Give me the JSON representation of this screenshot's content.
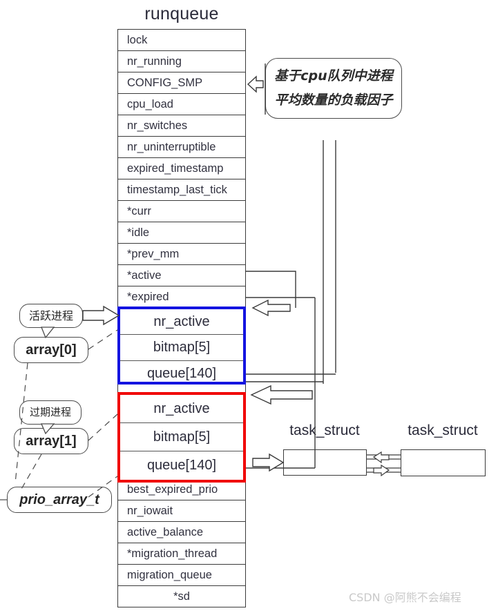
{
  "diagram": {
    "title": "runqueue",
    "runqueue_fields": [
      {
        "label": "lock",
        "align": "left"
      },
      {
        "label": "nr_running",
        "align": "left"
      },
      {
        "label": "CONFIG_SMP",
        "align": "left"
      },
      {
        "label": "cpu_load",
        "align": "left"
      },
      {
        "label": "nr_switches",
        "align": "left"
      },
      {
        "label": "nr_uninterruptible",
        "align": "left"
      },
      {
        "label": "expired_timestamp",
        "align": "left"
      },
      {
        "label": "timestamp_last_tick",
        "align": "left"
      },
      {
        "label": "*curr",
        "align": "left"
      },
      {
        "label": "*idle",
        "align": "left"
      },
      {
        "label": "*prev_mm",
        "align": "left"
      },
      {
        "label": "*active",
        "align": "left"
      },
      {
        "label": "*expired",
        "align": "left"
      },
      {
        "label": "",
        "align": "left"
      },
      {
        "label": "",
        "align": "left"
      },
      {
        "label": "",
        "align": "left"
      },
      {
        "label": "",
        "align": "left"
      },
      {
        "label": "",
        "align": "left"
      },
      {
        "label": "",
        "align": "left"
      },
      {
        "label": "",
        "align": "left"
      },
      {
        "label": "",
        "align": "left"
      },
      {
        "label": "best_expired_prio",
        "align": "left"
      },
      {
        "label": "nr_iowait",
        "align": "left"
      },
      {
        "label": "active_balance",
        "align": "left"
      },
      {
        "label": "*migration_thread",
        "align": "left"
      },
      {
        "label": "migration_queue",
        "align": "left"
      },
      {
        "label": "*sd",
        "align": "center"
      }
    ],
    "active_array": {
      "name": "array[0]",
      "border_color": "#1414e0",
      "rows": [
        "nr_active",
        "bitmap[5]",
        "queue[140]"
      ]
    },
    "expired_array": {
      "name": "array[1]",
      "border_color": "#f00000",
      "rows": [
        "nr_active",
        "bitmap[5]",
        "queue[140]"
      ]
    },
    "callout": {
      "line1": "基于cpu队列中进程",
      "line2": "平均数量的负载因子"
    },
    "left_labels": {
      "active_process": "活跃进程",
      "array0": "array[0]",
      "expired_process": "过期进程",
      "array1": "array[1]",
      "prio_array_t": "prio_array_t"
    },
    "task_structs": [
      {
        "title": "task_struct"
      },
      {
        "title": "task_struct"
      }
    ],
    "watermark": "CSDN @阿熊不会编程"
  }
}
